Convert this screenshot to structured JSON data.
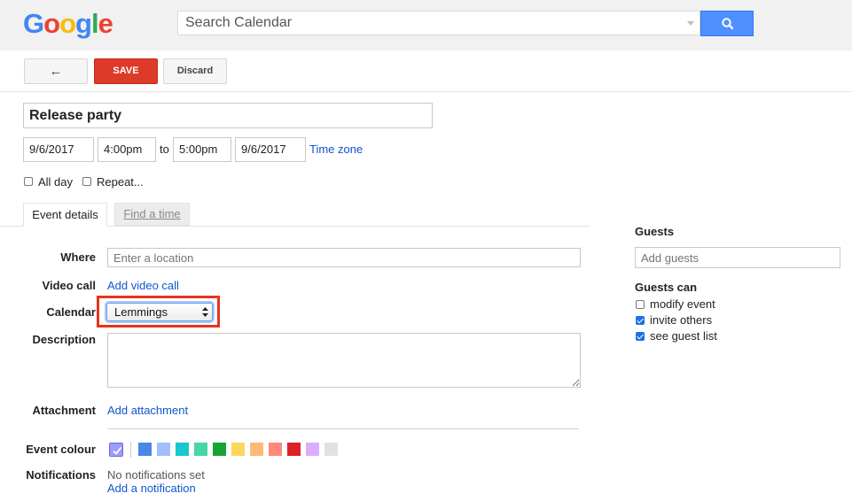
{
  "header": {
    "logo_letters": [
      {
        "ch": "G",
        "color": "#4285f4"
      },
      {
        "ch": "o",
        "color": "#ea4335"
      },
      {
        "ch": "o",
        "color": "#fbbc05"
      },
      {
        "ch": "g",
        "color": "#4285f4"
      },
      {
        "ch": "l",
        "color": "#34a853"
      },
      {
        "ch": "e",
        "color": "#ea4335"
      }
    ],
    "search_placeholder": "Search Calendar"
  },
  "toolbar": {
    "back_label": "←",
    "save_label": "SAVE",
    "discard_label": "Discard"
  },
  "event": {
    "title": "Release party",
    "start_date": "9/6/2017",
    "start_time": "4:00pm",
    "to_label": "to",
    "end_time": "5:00pm",
    "end_date": "9/6/2017",
    "time_zone_link": "Time zone",
    "all_day_label": "All day",
    "repeat_label": "Repeat..."
  },
  "tabs": {
    "details": "Event details",
    "find_time": "Find a time"
  },
  "details": {
    "where_label": "Where",
    "where_placeholder": "Enter a location",
    "video_label": "Video call",
    "video_link": "Add video call",
    "calendar_label": "Calendar",
    "calendar_value": "Lemmings",
    "description_label": "Description",
    "attachment_label": "Attachment",
    "attachment_link": "Add attachment",
    "colour_label": "Event colour",
    "colours": [
      "#4986e7",
      "#a4bdfc",
      "#16c8cf",
      "#46d6a8",
      "#17a531",
      "#fbd75b",
      "#ffb878",
      "#ff887c",
      "#dc2127",
      "#dbadff",
      "#e1e1e1"
    ],
    "selected_colour": "#9a9cff",
    "notifications_label": "Notifications",
    "notifications_value": "No notifications set",
    "add_notification_link": "Add a notification"
  },
  "guests": {
    "heading": "Guests",
    "input_placeholder": "Add guests",
    "can_heading": "Guests can",
    "permissions": [
      {
        "label": "modify event",
        "checked": false
      },
      {
        "label": "invite others",
        "checked": true
      },
      {
        "label": "see guest list",
        "checked": true
      }
    ]
  },
  "highlight_color": "#e8321e"
}
